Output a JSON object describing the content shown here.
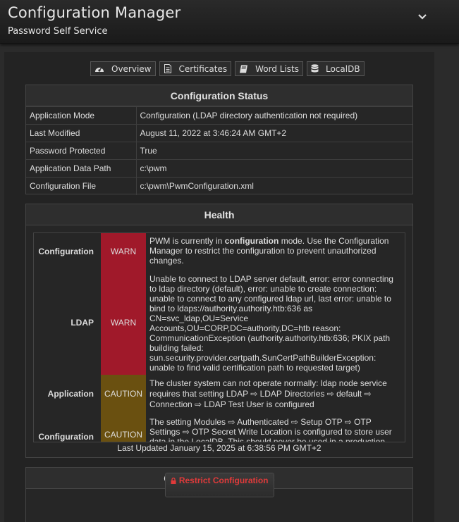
{
  "header": {
    "title": "Configuration Manager",
    "subtitle": "Password Self Service",
    "menu_icon": "chevron-down-icon"
  },
  "tabs": [
    {
      "label": "Overview",
      "icon": "dashboard-icon"
    },
    {
      "label": "Certificates",
      "icon": "document-icon"
    },
    {
      "label": "Word Lists",
      "icon": "book-icon"
    },
    {
      "label": "LocalDB",
      "icon": "database-icon"
    }
  ],
  "config_status": {
    "title": "Configuration Status",
    "rows": [
      {
        "key": "Application Mode",
        "value": "Configuration (LDAP directory authentication not required)"
      },
      {
        "key": "Last Modified",
        "value": "August 11, 2022 at 3:46:24 AM GMT+2"
      },
      {
        "key": "Password Protected",
        "value": "True"
      },
      {
        "key": "Application Data Path",
        "value": "c:\\pwm"
      },
      {
        "key": "Configuration File",
        "value": "c:\\pwm\\PwmConfiguration.xml"
      }
    ]
  },
  "health": {
    "title": "Health",
    "rows": [
      {
        "topic": "Configuration",
        "level": "WARN",
        "message_pre": "PWM is currently in ",
        "message_bold": "configuration",
        "message_post": " mode. Use the Configuration Manager to restrict the configuration to prevent unauthorized changes."
      },
      {
        "topic": "LDAP",
        "level": "WARN",
        "message_pre": "Unable to connect to LDAP server default, error: error connecting to ldap directory (default), error: unable to create connection: unable to connect to any configured ldap url, last error: unable to bind to ldaps://authority.authority.htb:636 as CN=svc_ldap,OU=Service Accounts,OU=CORP,DC=authority,DC=htb reason: CommunicationException (authority.authority.htb:636; PKIX path building failed: sun.security.provider.certpath.SunCertPathBuilderException: unable to find valid certification path to requested target)",
        "message_bold": "",
        "message_post": ""
      },
      {
        "topic": "Application",
        "level": "CAUTION",
        "message_pre": "The cluster system can not operate normally: ldap node service requires that setting LDAP ⇨ LDAP Directories ⇨ default ⇨ Connection ⇨ LDAP Test User is configured",
        "message_bold": "",
        "message_post": ""
      },
      {
        "topic": "Configuration",
        "level": "CAUTION",
        "message_pre": "The setting Modules ⇨ Authenticated ⇨ Setup OTP ⇨ OTP Settings ⇨ OTP Secret Write Location is configured to store user data in the LocalDB. This should never be used in a production environment.",
        "message_bold": "",
        "message_post": ""
      }
    ],
    "last_updated": "Last Updated January 15, 2025 at 6:38:56 PM GMT+2"
  },
  "activities": {
    "title": "Configuration Activities",
    "restrict_button": "Restrict Configuration",
    "restrict_icon": "lock-icon"
  },
  "colors": {
    "warn": "#a0192a",
    "caution": "#6a5010",
    "restrict_text": "#e03a3a"
  }
}
